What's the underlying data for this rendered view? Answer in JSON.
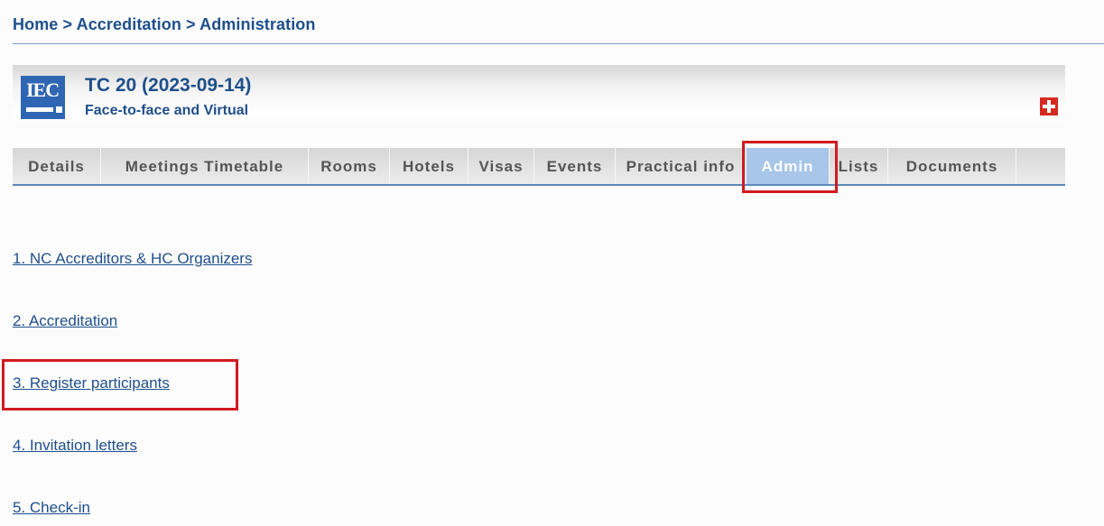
{
  "breadcrumb": {
    "home": "Home",
    "separator": ">",
    "accreditation": "Accreditation",
    "administration": "Administration"
  },
  "meeting": {
    "logo_text": "IEC",
    "title": "TC 20 (2023-09-14)",
    "subtitle": "Face-to-face and Virtual"
  },
  "tabs": [
    {
      "label": "Details"
    },
    {
      "label": "Meetings Timetable"
    },
    {
      "label": "Rooms"
    },
    {
      "label": "Hotels"
    },
    {
      "label": "Visas"
    },
    {
      "label": "Events"
    },
    {
      "label": "Practical info"
    },
    {
      "label": "Admin",
      "active": true
    },
    {
      "label": "Lists"
    },
    {
      "label": "Documents"
    }
  ],
  "admin_links": [
    {
      "label": "1. NC Accreditors & HC Organizers"
    },
    {
      "label": "2. Accreditation"
    },
    {
      "label": "3. Register participants"
    },
    {
      "label": "4. Invitation letters"
    },
    {
      "label": "5. Check-in"
    }
  ],
  "colors": {
    "brand_blue": "#1e4f8c",
    "active_tab": "#a7c6e8",
    "highlight_red": "#d11b20",
    "flag_red": "#d52b1e"
  },
  "icons": {
    "logo": "iec-logo-icon",
    "flag": "swiss-flag-icon"
  }
}
